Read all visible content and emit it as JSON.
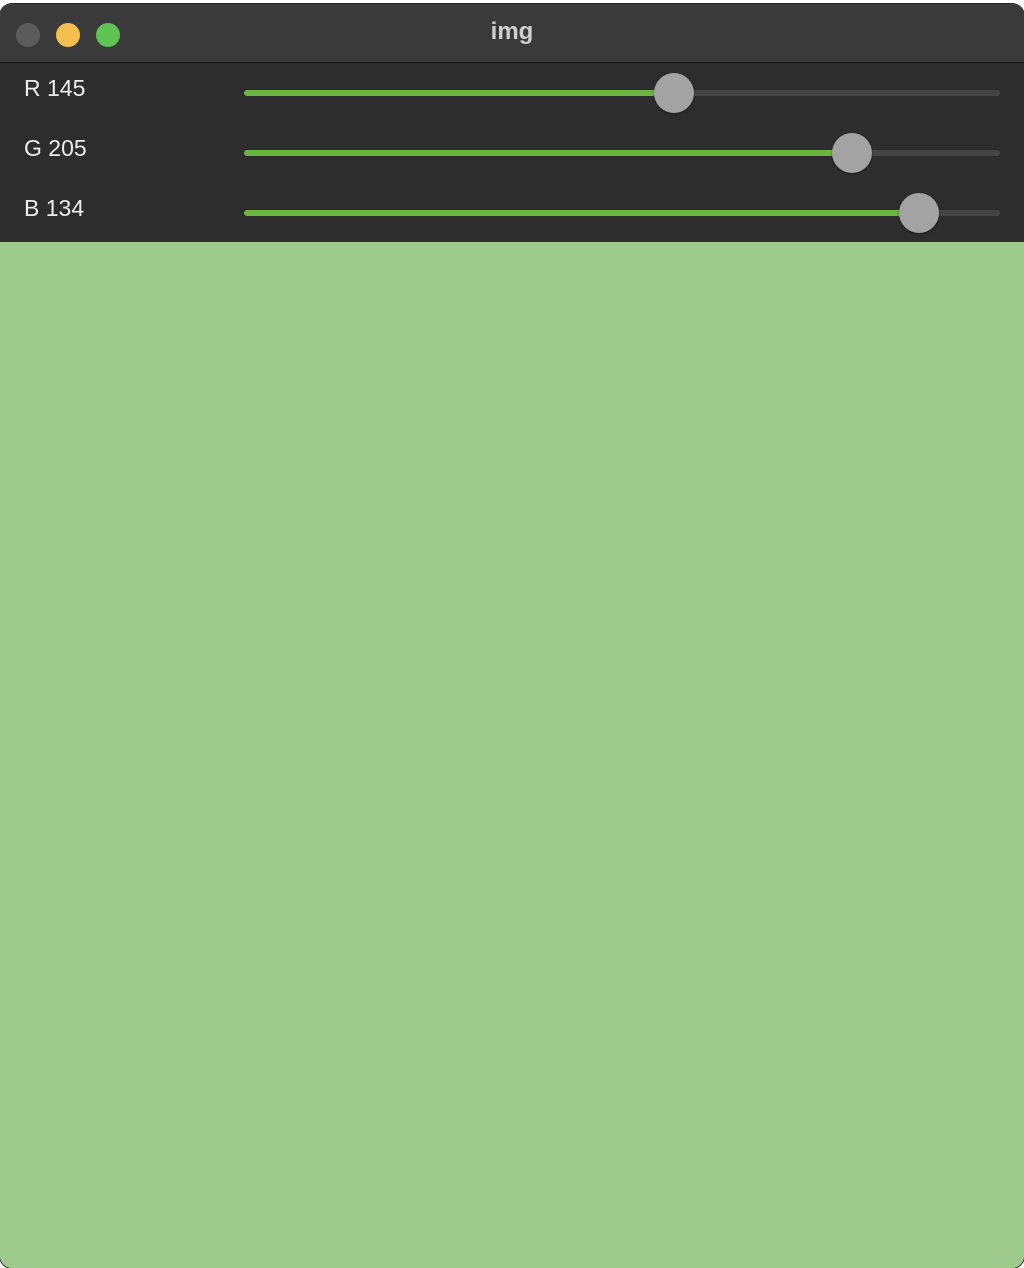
{
  "window": {
    "title": "img"
  },
  "sliders": [
    {
      "id": "r",
      "label": "R 145",
      "value": 145,
      "max": 255,
      "color": "#6ab43f"
    },
    {
      "id": "g",
      "label": "G 205",
      "value": 205,
      "max": 255,
      "color": "#6ab43f"
    },
    {
      "id": "b",
      "label": "B 134",
      "value": 134,
      "max": 150,
      "color": "#6ab43f"
    }
  ],
  "preview": {
    "color": "#9ecb8d"
  }
}
